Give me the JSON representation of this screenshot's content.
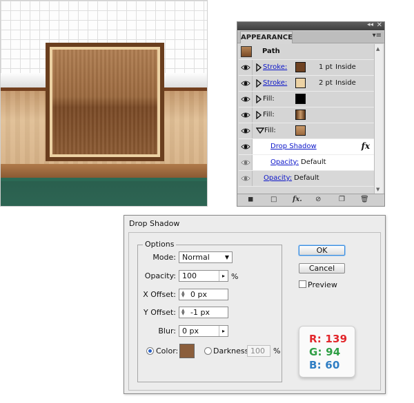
{
  "appearance": {
    "tab_label": "APPEARANCE",
    "collapse_glyph": "◂◂",
    "close_glyph": "✕",
    "menu_glyph": "▾≡",
    "path_label": "Path",
    "rows": [
      {
        "kind": "stroke",
        "label": "Stroke:",
        "weight": "1 pt",
        "position": "Inside",
        "swatch_color": "#6e4222"
      },
      {
        "kind": "stroke",
        "label": "Stroke:",
        "weight": "2 pt",
        "position": "Inside",
        "swatch_color": "#ecd2a4"
      },
      {
        "kind": "fill",
        "label": "Fill:",
        "swatch_color": "#000000"
      },
      {
        "kind": "fill",
        "label": "Fill:",
        "swatch_color": "#8a5a33"
      },
      {
        "kind": "fill",
        "label": "Fill:",
        "swatch_color": "#b8875a"
      }
    ],
    "effect_label": "Drop Shadow",
    "fx_mark": "fx",
    "effect_opacity_label": "Opacity:",
    "effect_opacity_value": "Default",
    "object_opacity_label": "Opacity:",
    "object_opacity_value": "Default",
    "footer_icons": [
      "stroke-square-icon",
      "fill-square-icon",
      "fx-menu-icon",
      "clear-icon",
      "duplicate-icon",
      "trash-icon"
    ]
  },
  "dialog": {
    "title": "Drop Shadow",
    "options_legend": "Options",
    "mode_label": "Mode:",
    "mode_value": "Normal",
    "opacity_label": "Opacity:",
    "opacity_value": "100",
    "opacity_unit": "%",
    "x_offset_label": "X Offset:",
    "x_offset_value": "0 px",
    "y_offset_label": "Y Offset:",
    "y_offset_value": "-1 px",
    "blur_label": "Blur:",
    "blur_value": "0 px",
    "color_label": "Color:",
    "color_value": "#8b5e3c",
    "darkness_label": "Darkness:",
    "darkness_value": "100",
    "darkness_unit": "%",
    "ok_label": "OK",
    "cancel_label": "Cancel",
    "preview_label": "Preview"
  },
  "rgb": {
    "r": "R: 139",
    "g": "G: 94",
    "b": "B: 60",
    "r_color": "#e2262b",
    "g_color": "#2e9e44",
    "b_color": "#2f7ec4"
  }
}
